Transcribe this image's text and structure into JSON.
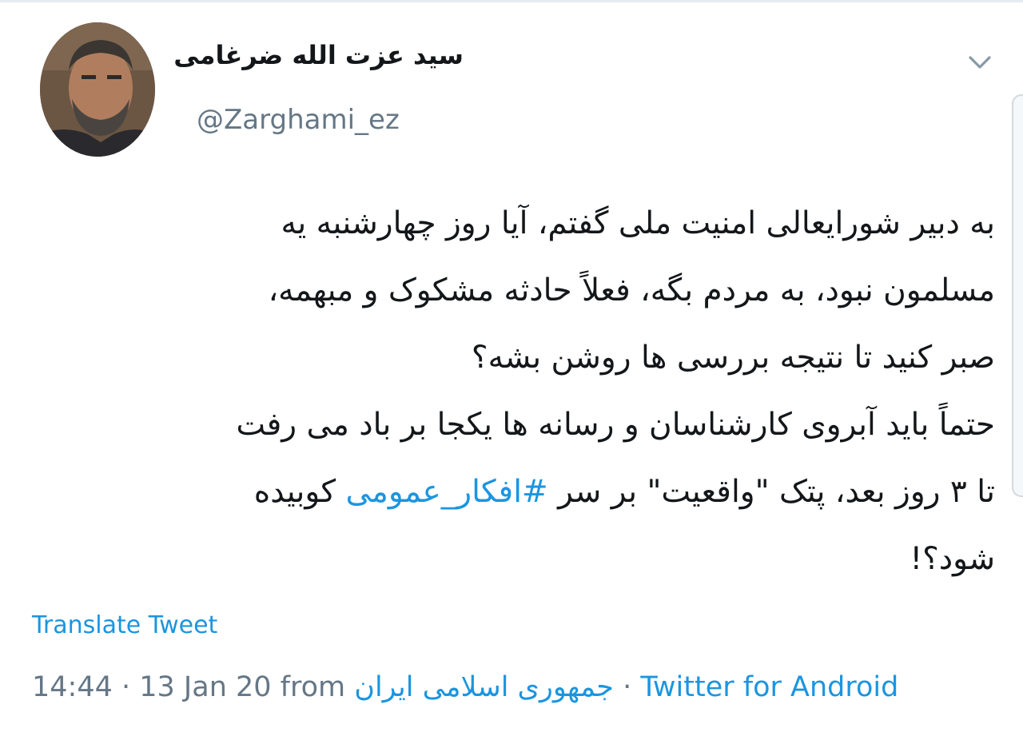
{
  "author": {
    "display_name": "سید عزت الله ضرغامی",
    "handle": "@Zarghami_ez"
  },
  "tweet": {
    "line1": "به دبیر شورایعالی امنیت ملی گفتم، آیا روز چهارشنبه یه",
    "line2": "مسلمون نبود، به مردم بگه، فعلاً حادثه مشکوک و مبهمه،",
    "line3": "صبر کنید تا نتیجه بررسی ها روشن بشه؟",
    "line4": "حتماً باید آبروی کارشناسان و رسانه ها یکجا بر باد می رفت",
    "line5_before": "تا ۳ روز بعد، پتک \"واقعیت\" بر سر ",
    "hashtag": "#افکار_عمومی",
    "line5_after": " کوبیده",
    "line6": "شود؟!"
  },
  "translate_label": "Translate Tweet",
  "meta": {
    "time": "14:44",
    "sep1": " · ",
    "date": "13 Jan 20",
    "from": " from ",
    "location": "جمهوری اسلامی ایران",
    "sep2": " · ",
    "source": "Twitter for Android"
  },
  "icons": {
    "menu": "chevron-down-icon"
  },
  "colors": {
    "link": "#1b95e0",
    "secondary_text": "#657786",
    "primary_text": "#14171a"
  }
}
